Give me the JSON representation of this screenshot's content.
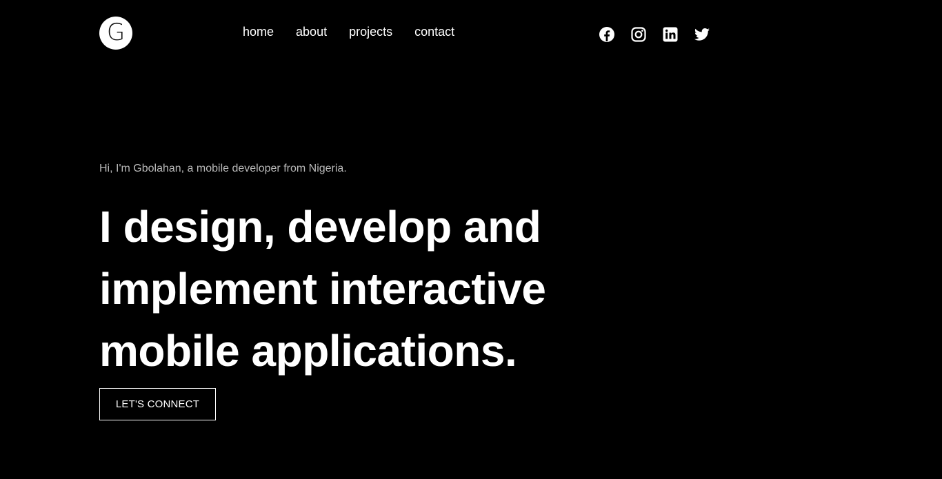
{
  "header": {
    "logo_letter": "G",
    "nav": [
      {
        "label": "home"
      },
      {
        "label": "about"
      },
      {
        "label": "projects"
      },
      {
        "label": "contact"
      }
    ],
    "social": [
      {
        "icon": "facebook-icon"
      },
      {
        "icon": "instagram-icon"
      },
      {
        "icon": "linkedin-icon"
      },
      {
        "icon": "twitter-icon"
      }
    ]
  },
  "hero": {
    "intro": "Hi, I'm Gbolahan, a mobile developer from Nigeria.",
    "headline_lines": [
      "I design, develop and",
      "implement interactive",
      "mobile applications."
    ],
    "cta_label": "LET'S CONNECT"
  },
  "colors": {
    "background": "#000000",
    "text": "#ffffff",
    "muted_text": "#b9b9b9"
  }
}
